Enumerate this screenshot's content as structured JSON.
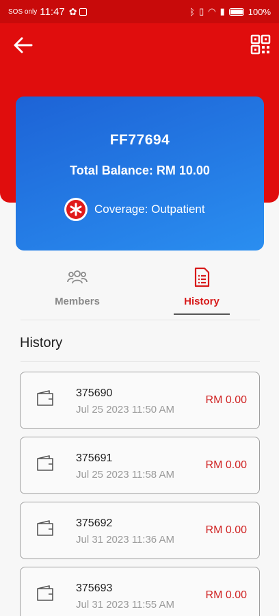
{
  "status_bar": {
    "sos": "SOS only",
    "time": "11:47",
    "battery_percent": "100%"
  },
  "header": {
    "back_icon": "arrow-left-icon",
    "qr_icon": "qr-code-icon"
  },
  "card": {
    "code": "FF77694",
    "balance": "Total Balance: RM 10.00",
    "coverage": "Coverage: Outpatient",
    "coverage_icon": "medical-star-icon",
    "colors": {
      "start": "#1d63d6",
      "end": "#2a8ef0"
    }
  },
  "tabs": [
    {
      "label": "Members",
      "icon": "members-group-icon",
      "active": false
    },
    {
      "label": "History",
      "icon": "document-list-icon",
      "active": true
    }
  ],
  "history": {
    "title": "History",
    "items": [
      {
        "id": "375690",
        "date": "Jul 25 2023 11:50 AM",
        "amount": "RM 0.00"
      },
      {
        "id": "375691",
        "date": "Jul 25 2023 11:58 AM",
        "amount": "RM 0.00"
      },
      {
        "id": "375692",
        "date": "Jul 31 2023 11:36 AM",
        "amount": "RM 0.00"
      },
      {
        "id": "375693",
        "date": "Jul 31 2023 11:55 AM",
        "amount": "RM 0.00"
      }
    ]
  },
  "colors": {
    "header_red": "#e00d0d",
    "accent_red": "#d71a1a",
    "amount_red": "#d02424"
  }
}
